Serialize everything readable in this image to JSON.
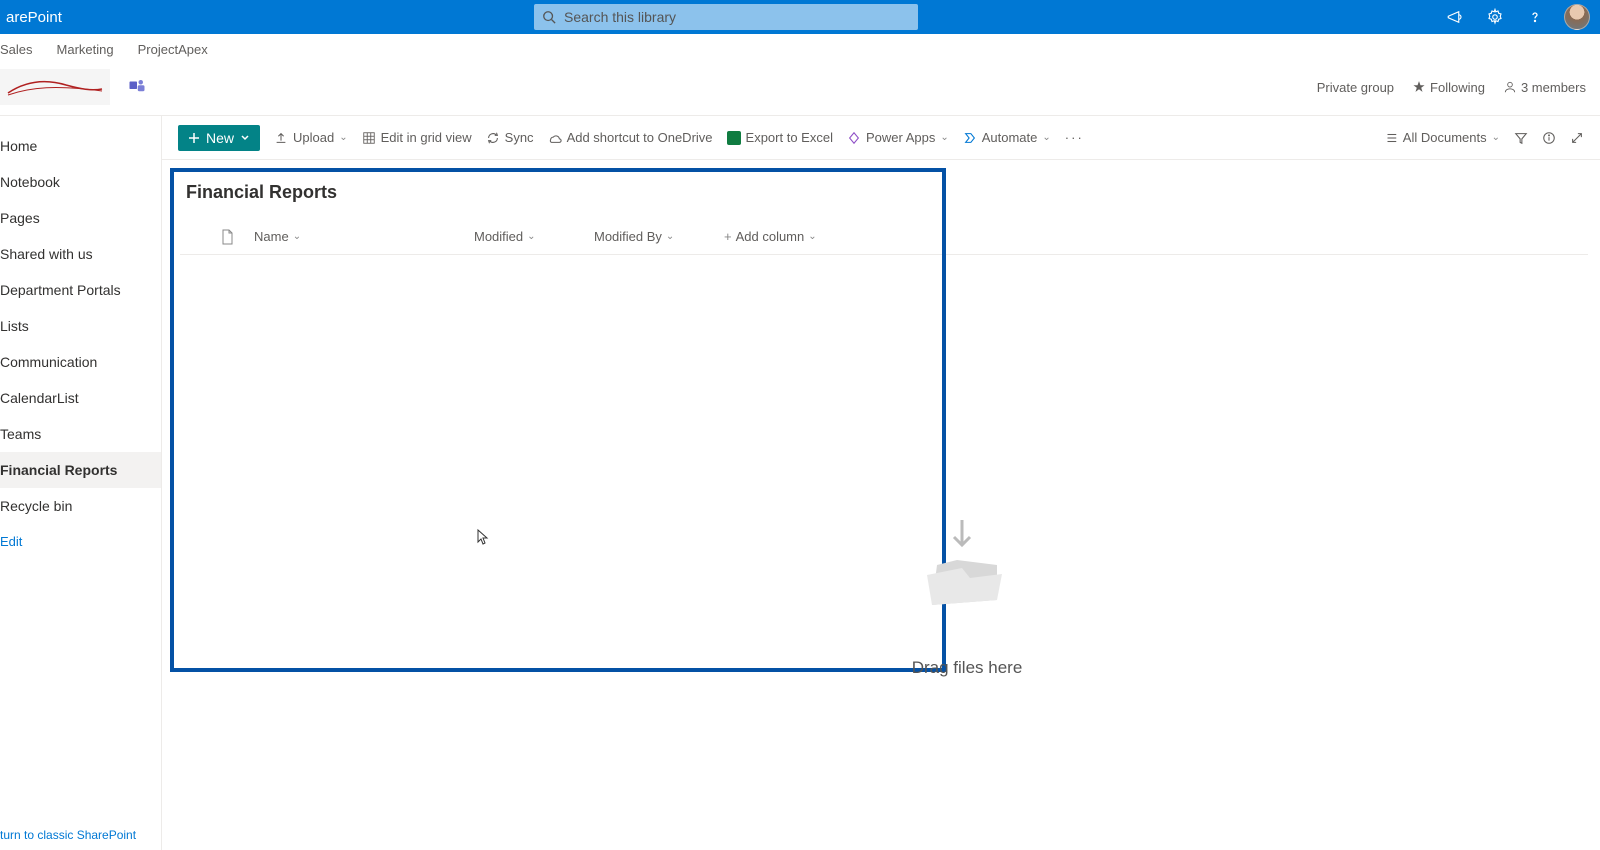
{
  "suite": {
    "app_name": "arePoint",
    "search_placeholder": "Search this library"
  },
  "hub_nav": [
    "Sales",
    "Marketing",
    "ProjectApex"
  ],
  "site": {
    "privacy": "Private group",
    "follow": "Following",
    "members": "3 members"
  },
  "left_nav": {
    "items": [
      "Home",
      "Notebook",
      "Pages",
      "Shared with us",
      "Department Portals",
      "Lists",
      "Communication",
      "CalendarList",
      "Teams",
      "Financial Reports",
      "Recycle bin"
    ],
    "active_index": 9,
    "edit": "Edit",
    "classic": "turn to classic SharePoint"
  },
  "cmd_bar": {
    "new": "New",
    "upload": "Upload",
    "grid": "Edit in grid view",
    "sync": "Sync",
    "shortcut": "Add shortcut to OneDrive",
    "export": "Export to Excel",
    "powerapps": "Power Apps",
    "automate": "Automate",
    "view": "All Documents"
  },
  "library": {
    "title": "Financial Reports",
    "columns": {
      "name": "Name",
      "modified": "Modified",
      "modified_by": "Modified By",
      "add": "Add column"
    },
    "empty_text": "Drag files here"
  }
}
